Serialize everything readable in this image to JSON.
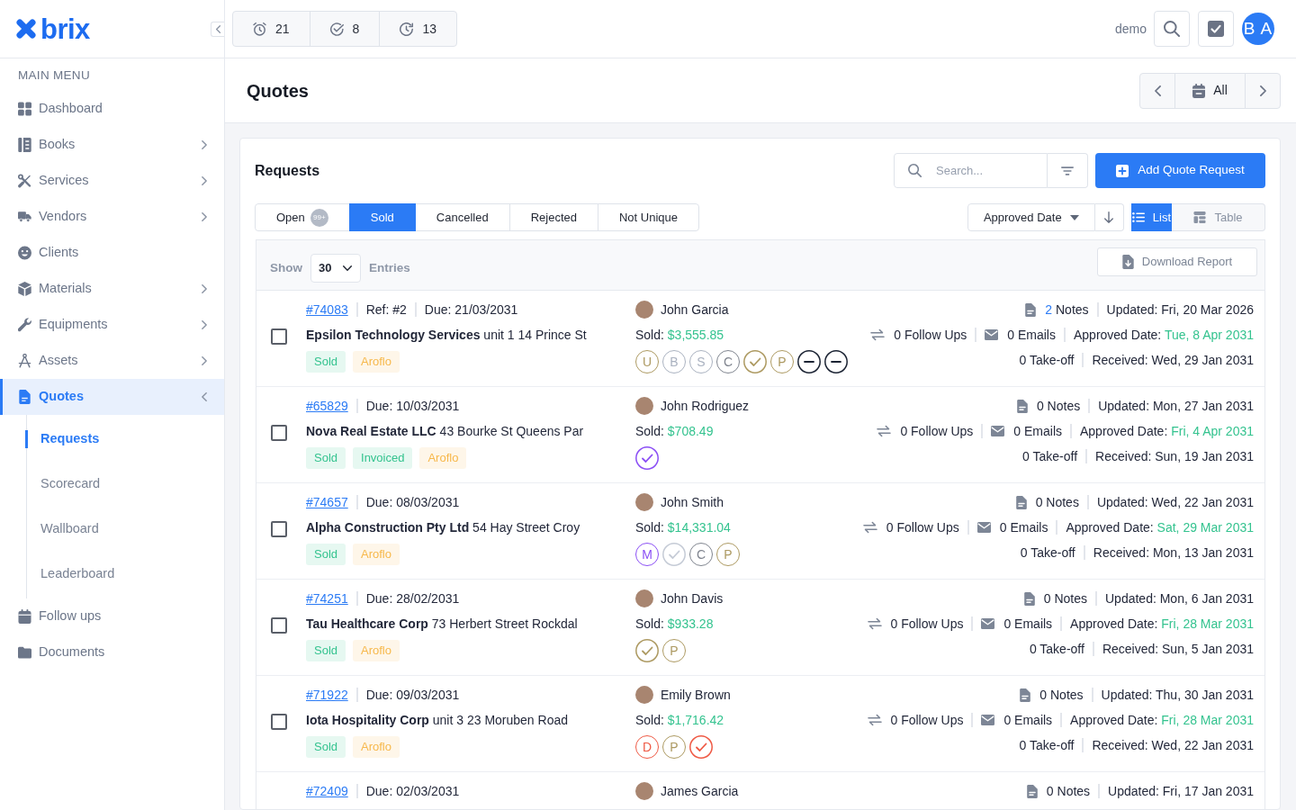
{
  "brand": {
    "name": "brix"
  },
  "sidebar": {
    "heading": "MAIN MENU",
    "items": [
      {
        "label": "Dashboard",
        "selected": false
      },
      {
        "label": "Books",
        "expanded": false,
        "selected": false
      },
      {
        "label": "Services",
        "expanded": false,
        "selected": false
      },
      {
        "label": "Vendors",
        "expanded": false,
        "selected": false
      },
      {
        "label": "Clients",
        "selected": false
      },
      {
        "label": "Materials",
        "expanded": false,
        "selected": false
      },
      {
        "label": "Equipments",
        "expanded": false,
        "selected": false
      },
      {
        "label": "Assets",
        "expanded": false,
        "selected": false
      },
      {
        "label": "Quotes",
        "expanded": true,
        "selected": true,
        "children": [
          {
            "label": "Requests",
            "selected": true
          },
          {
            "label": "Scorecard",
            "selected": false
          },
          {
            "label": "Wallboard",
            "selected": false
          },
          {
            "label": "Leaderboard",
            "selected": false
          }
        ]
      },
      {
        "label": "Follow ups",
        "selected": false
      },
      {
        "label": "Documents",
        "selected": false
      }
    ]
  },
  "topbar": {
    "counters": [
      {
        "value": "21"
      },
      {
        "value": "8"
      },
      {
        "value": "13"
      }
    ],
    "user": "demo",
    "avatar": "B A"
  },
  "page": {
    "title": "Quotes",
    "period": "All"
  },
  "requests": {
    "title": "Requests",
    "search": {
      "placeholder": "Search..."
    },
    "add_button": "Add Quote Request",
    "status_tabs": [
      {
        "label": "Open",
        "count": "99+",
        "selected": false
      },
      {
        "label": "Sold",
        "selected": true
      },
      {
        "label": "Cancelled",
        "selected": false
      },
      {
        "label": "Rejected",
        "selected": false
      },
      {
        "label": "Not Unique",
        "selected": false
      }
    ],
    "sort": {
      "field": "Approved Date",
      "descending": true
    },
    "views": [
      {
        "label": "List",
        "selected": true
      },
      {
        "label": "Table",
        "selected": false
      }
    ],
    "list": {
      "show_label": "Show",
      "page_size": "30",
      "entries_label": "Entries",
      "download_button": "Download Report",
      "rows": [
        {
          "checked": false,
          "number": "#74083",
          "ref": "Ref: #2",
          "due": "Due: 21/03/2031",
          "company": "Epsilon Technology Services",
          "address": "unit 1 14 Prince St",
          "tags": [
            {
              "label": "Sold",
              "color": "#34c38f"
            },
            {
              "label": "Aroflo",
              "color": "#f7b84b"
            }
          ],
          "contact": "John Garcia",
          "sold": {
            "label": "Sold:",
            "amount": "$3,555.85"
          },
          "stages": [
            {
              "kind": "letter",
              "text": "U",
              "color": "#ad9a62"
            },
            {
              "kind": "letter",
              "text": "B",
              "color": "#aab2c0"
            },
            {
              "kind": "letter",
              "text": "S",
              "color": "#aab2c0"
            },
            {
              "kind": "letter",
              "text": "C",
              "color": "#80858f"
            },
            {
              "kind": "check",
              "color": "#ad9a62"
            },
            {
              "kind": "letter",
              "text": "P",
              "color": "#ad9a62"
            },
            {
              "kind": "dash",
              "color": "#1c2434"
            },
            {
              "kind": "dash",
              "color": "#1c2434"
            }
          ],
          "notes": {
            "count": "2",
            "label": "Notes",
            "linked": true
          },
          "updated": "Updated: Fri, 20 Mar 2026",
          "follow_ups": "0 Follow Ups",
          "emails": "0 Emails",
          "approved": {
            "label": "Approved Date:",
            "date": "Tue, 8 Apr 2031"
          },
          "takeoff": "0 Take-off",
          "received": "Received: Wed, 29 Jan 2031"
        },
        {
          "checked": false,
          "number": "#65829",
          "due": "Due: 10/03/2031",
          "company": "Nova Real Estate LLC",
          "address": "43 Bourke St Queens Par",
          "tags": [
            {
              "label": "Sold",
              "color": "#34c38f"
            },
            {
              "label": "Invoiced",
              "color": "#34c38f"
            },
            {
              "label": "Aroflo",
              "color": "#f7b84b"
            }
          ],
          "contact": "John Rodriguez",
          "sold": {
            "label": "Sold:",
            "amount": "$708.49"
          },
          "stages": [
            {
              "kind": "check",
              "color": "#8b4ff5"
            }
          ],
          "notes": {
            "count": "0",
            "label": "Notes",
            "linked": false
          },
          "updated": "Updated: Mon, 27 Jan 2031",
          "follow_ups": "0 Follow Ups",
          "emails": "0 Emails",
          "approved": {
            "label": "Approved Date:",
            "date": "Fri, 4 Apr 2031"
          },
          "takeoff": "0 Take-off",
          "received": "Received: Sun, 19 Jan 2031"
        },
        {
          "checked": false,
          "number": "#74657",
          "due": "Due: 08/03/2031",
          "company": "Alpha Construction Pty Ltd",
          "address": "54 Hay Street Croy",
          "tags": [
            {
              "label": "Sold",
              "color": "#34c38f"
            },
            {
              "label": "Aroflo",
              "color": "#f7b84b"
            }
          ],
          "contact": "John Smith",
          "sold": {
            "label": "Sold:",
            "amount": "$14,331.04"
          },
          "stages": [
            {
              "kind": "letter",
              "text": "M",
              "color": "#8b4ff5"
            },
            {
              "kind": "check",
              "color": "#c5cbd6"
            },
            {
              "kind": "letter",
              "text": "C",
              "color": "#80858f"
            },
            {
              "kind": "letter",
              "text": "P",
              "color": "#ad9a62"
            }
          ],
          "notes": {
            "count": "0",
            "label": "Notes",
            "linked": false
          },
          "updated": "Updated: Wed, 22 Jan 2031",
          "follow_ups": "0 Follow Ups",
          "emails": "0 Emails",
          "approved": {
            "label": "Approved Date:",
            "date": "Sat, 29 Mar 2031"
          },
          "takeoff": "0 Take-off",
          "received": "Received: Mon, 13 Jan 2031"
        },
        {
          "checked": false,
          "number": "#74251",
          "due": "Due: 28/02/2031",
          "company": "Tau Healthcare Corp",
          "address": "73 Herbert Street Rockdal",
          "tags": [
            {
              "label": "Sold",
              "color": "#34c38f"
            },
            {
              "label": "Aroflo",
              "color": "#f7b84b"
            }
          ],
          "contact": "John Davis",
          "sold": {
            "label": "Sold:",
            "amount": "$933.28"
          },
          "stages": [
            {
              "kind": "check",
              "color": "#ad9a62"
            },
            {
              "kind": "letter",
              "text": "P",
              "color": "#ad9a62"
            }
          ],
          "notes": {
            "count": "0",
            "label": "Notes",
            "linked": false
          },
          "updated": "Updated: Mon, 6 Jan 2031",
          "follow_ups": "0 Follow Ups",
          "emails": "0 Emails",
          "approved": {
            "label": "Approved Date:",
            "date": "Fri, 28 Mar 2031"
          },
          "takeoff": "0 Take-off",
          "received": "Received: Sun, 5 Jan 2031"
        },
        {
          "checked": false,
          "number": "#71922",
          "due": "Due: 09/03/2031",
          "company": "Iota Hospitality Corp",
          "address": "unit 3 23 Moruben Road",
          "tags": [
            {
              "label": "Sold",
              "color": "#34c38f"
            },
            {
              "label": "Aroflo",
              "color": "#f7b84b"
            }
          ],
          "contact": "Emily Brown",
          "sold": {
            "label": "Sold:",
            "amount": "$1,716.42"
          },
          "stages": [
            {
              "kind": "letter",
              "text": "D",
              "color": "#ef5a45"
            },
            {
              "kind": "letter",
              "text": "P",
              "color": "#ad9a62"
            },
            {
              "kind": "check",
              "color": "#ef5a45"
            }
          ],
          "notes": {
            "count": "0",
            "label": "Notes",
            "linked": false
          },
          "updated": "Updated: Thu, 30 Jan 2031",
          "follow_ups": "0 Follow Ups",
          "emails": "0 Emails",
          "approved": {
            "label": "Approved Date:",
            "date": "Fri, 28 Mar 2031"
          },
          "takeoff": "0 Take-off",
          "received": "Received: Wed, 22 Jan 2031"
        },
        {
          "number": "#72409",
          "due": "Due: 02/03/2031",
          "contact": "James Garcia",
          "notes": {
            "count": "0",
            "label": "Notes",
            "linked": false
          },
          "updated": "Updated: Fri, 17 Jan 2031"
        }
      ]
    }
  }
}
